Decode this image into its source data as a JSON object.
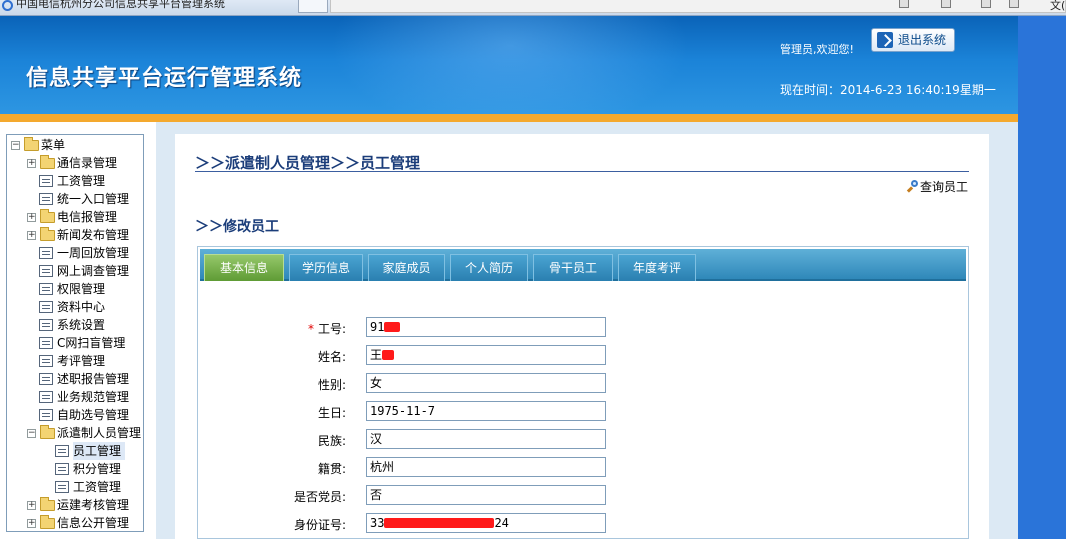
{
  "browser": {
    "tab_title": "中国电信杭州分公司信息共享平台管理系统",
    "corner_text": "文("
  },
  "header": {
    "system_title": "信息共享平台运行管理系统",
    "welcome": "管理员,欢迎您!",
    "logout_label": "退出系统",
    "time_label": "现在时间：2014-6-23 16:40:19星期一"
  },
  "sidebar": {
    "items": [
      {
        "label": "菜单",
        "level": 0,
        "kind": "root"
      },
      {
        "label": "通信录管理",
        "level": 1,
        "kind": "folder-collapsed"
      },
      {
        "label": "工资管理",
        "level": 1,
        "kind": "page"
      },
      {
        "label": "统一入口管理",
        "level": 1,
        "kind": "page"
      },
      {
        "label": "电信报管理",
        "level": 1,
        "kind": "folder-collapsed"
      },
      {
        "label": "新闻发布管理",
        "level": 1,
        "kind": "folder-collapsed"
      },
      {
        "label": "一周回放管理",
        "level": 1,
        "kind": "page"
      },
      {
        "label": "网上调查管理",
        "level": 1,
        "kind": "page"
      },
      {
        "label": "权限管理",
        "level": 1,
        "kind": "page"
      },
      {
        "label": "资料中心",
        "level": 1,
        "kind": "page"
      },
      {
        "label": "系统设置",
        "level": 1,
        "kind": "page"
      },
      {
        "label": "C网扫盲管理",
        "level": 1,
        "kind": "page"
      },
      {
        "label": "考评管理",
        "level": 1,
        "kind": "page"
      },
      {
        "label": "述职报告管理",
        "level": 1,
        "kind": "page"
      },
      {
        "label": "业务规范管理",
        "level": 1,
        "kind": "page"
      },
      {
        "label": "自助选号管理",
        "level": 1,
        "kind": "page"
      },
      {
        "label": "派遣制人员管理",
        "level": 1,
        "kind": "folder-expanded"
      },
      {
        "label": "员工管理",
        "level": 2,
        "kind": "page",
        "selected": true
      },
      {
        "label": "积分管理",
        "level": 2,
        "kind": "page"
      },
      {
        "label": "工资管理",
        "level": 2,
        "kind": "page"
      },
      {
        "label": "运建考核管理",
        "level": 1,
        "kind": "folder-collapsed"
      },
      {
        "label": "信息公开管理",
        "level": 1,
        "kind": "folder-collapsed"
      }
    ]
  },
  "main": {
    "breadcrumb": "＞＞派遣制人员管理＞＞员工管理",
    "query_link": "查询员工",
    "section_title": "＞＞修改员工",
    "tabs": [
      {
        "label": "基本信息",
        "active": true
      },
      {
        "label": "学历信息",
        "active": false
      },
      {
        "label": "家庭成员",
        "active": false
      },
      {
        "label": "个人简历",
        "active": false
      },
      {
        "label": "骨干员工",
        "active": false
      },
      {
        "label": "年度考评",
        "active": false
      }
    ],
    "fields": [
      {
        "label": "工号:",
        "value": "91",
        "required": true
      },
      {
        "label": "姓名:",
        "value": "王",
        "required": false
      },
      {
        "label": "性别:",
        "value": "女",
        "required": false
      },
      {
        "label": "生日:",
        "value": "1975-11-7",
        "required": false
      },
      {
        "label": "民族:",
        "value": "汉",
        "required": false
      },
      {
        "label": "籍贯:",
        "value": "杭州",
        "required": false
      },
      {
        "label": "是否党员:",
        "value": "否",
        "required": false
      },
      {
        "label": "身份证号:",
        "value": "33",
        "value_suffix": "24",
        "required": false
      }
    ]
  },
  "colors": {
    "header_blue": "#1b83d8",
    "accent_orange": "#f4a92e",
    "title_navy": "#1b3d7a",
    "tab_active_green": "#5f9b35",
    "tab_blue": "#2f88b9",
    "required_red": "#e00000"
  }
}
